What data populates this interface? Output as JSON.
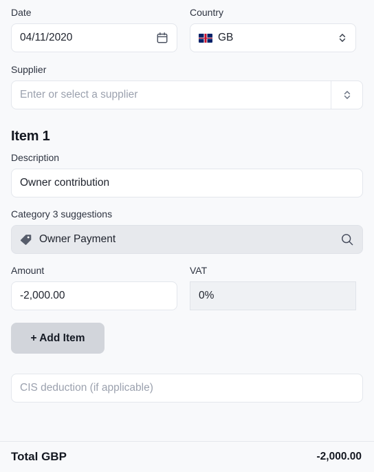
{
  "form": {
    "date": {
      "label": "Date",
      "value": "04/11/2020",
      "icon": "calendar-icon"
    },
    "country": {
      "label": "Country",
      "value": "GB",
      "flag": "gb-flag-icon",
      "icon": "chevron-up-down-icon"
    },
    "supplier": {
      "label": "Supplier",
      "placeholder": "Enter or select a supplier",
      "value": "",
      "icon": "chevron-up-down-icon"
    },
    "item": {
      "heading": "Item 1",
      "description": {
        "label": "Description",
        "value": "Owner contribution"
      },
      "category": {
        "label": "Category 3 suggestions",
        "suggestion": "Owner Payment",
        "tag_icon": "tag-icon",
        "search_icon": "search-icon"
      },
      "amount": {
        "label": "Amount",
        "value": "-2,000.00"
      },
      "vat": {
        "label": "VAT",
        "value": "0%"
      }
    },
    "add_item_label": "+ Add Item",
    "cis": {
      "placeholder": "CIS deduction (if applicable)",
      "value": ""
    },
    "total": {
      "label": "Total GBP",
      "value": "-2,000.00"
    }
  },
  "colors": {
    "page_background": "#f8f9fb",
    "input_background": "#ffffff",
    "input_border": "#e3e6ec",
    "suggestion_background": "#e7e9ed",
    "vat_background": "#eff1f4",
    "button_background": "#d2d5db",
    "text_primary": "#1f2430",
    "text_placeholder": "#9ba1ae"
  }
}
